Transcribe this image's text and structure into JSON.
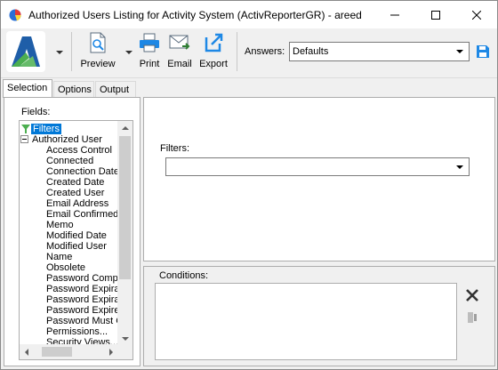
{
  "window": {
    "title": "Authorized Users Listing for Activity System (ActivReporterGR) - areed"
  },
  "toolbar": {
    "preview_label": "Preview",
    "print_label": "Print",
    "email_label": "Email",
    "export_label": "Export",
    "answers_label": "Answers:",
    "answers_value": "Defaults"
  },
  "tabs": [
    {
      "label": "Selection",
      "active": true
    },
    {
      "label": "Options",
      "active": false
    },
    {
      "label": "Output",
      "active": false
    }
  ],
  "fields_panel": {
    "label": "Fields:",
    "root_label": "Filters",
    "group_label": "Authorized User",
    "items": [
      "Access Control",
      "Connected",
      "Connection Date",
      "Created Date",
      "Created User",
      "Email Address",
      "Email Confirmed",
      "Memo",
      "Modified Date",
      "Modified User",
      "Name",
      "Obsolete",
      "Password Compl",
      "Password Expira",
      "Password Expira",
      "Password Expire",
      "Password Must C",
      "Permissions...",
      "Security Views..."
    ]
  },
  "filters_panel": {
    "label": "Filters:",
    "value": ""
  },
  "conditions_panel": {
    "label": "Conditions:"
  },
  "colors": {
    "selection": "#0078d7",
    "logo_blue": "#1f5ea8",
    "logo_green": "#4caf50",
    "icon_blue": "#1e88e5"
  }
}
